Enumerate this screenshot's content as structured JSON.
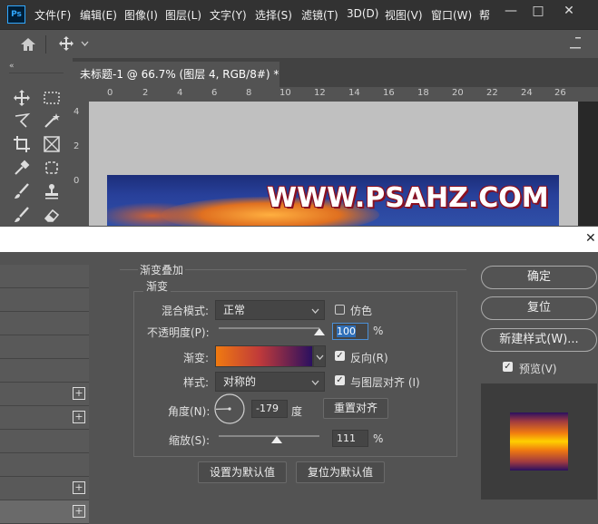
{
  "menubar": {
    "logo": "Ps",
    "items": [
      "文件(F)",
      "编辑(E)",
      "图像(I)",
      "图层(L)",
      "文字(Y)",
      "选择(S)",
      "滤镜(T)",
      "3D(D)",
      "视图(V)",
      "窗口(W)",
      "帮"
    ],
    "window_controls": [
      "—",
      "□",
      "✕"
    ]
  },
  "document": {
    "tab_title": "未标题-1 @ 66.7% (图层 4, RGB/8#) *",
    "tab_close": "×",
    "ruler_h": [
      "0",
      "2",
      "4",
      "6",
      "8",
      "10",
      "12",
      "14",
      "16",
      "18",
      "20",
      "22",
      "24",
      "26"
    ],
    "ruler_v": [
      "4",
      "2",
      "0"
    ],
    "watermark": "WWW.PSAHZ.COM"
  },
  "dialog": {
    "close": "✕",
    "section_title": "渐变叠加",
    "group_title": "渐变",
    "blend_mode_label": "混合模式:",
    "blend_mode_value": "正常",
    "dither_label": "仿色",
    "opacity_label": "不透明度(P):",
    "opacity_value": "100",
    "percent": "%",
    "gradient_label": "渐变:",
    "reverse_label": "反向(R)",
    "style_label": "样式:",
    "style_value": "对称的",
    "align_label": "与图层对齐 (I)",
    "angle_label": "角度(N):",
    "angle_value": "-179",
    "degree": "度",
    "reset_align_button": "重置对齐",
    "scale_label": "缩放(S):",
    "scale_value": "111",
    "set_default_button": "设置为默认值",
    "reset_default_button": "复位为默认值",
    "ok_button": "确定",
    "reset_button": "复位",
    "new_style_button": "新建样式(W)...",
    "preview_label": "预览(V)",
    "opacity_level": 1.0,
    "scale_level": 0.58,
    "checkbox_states": {
      "dither": false,
      "reverse": true,
      "align": true,
      "preview": true
    },
    "colors": {
      "gradient_start": "#f07a10",
      "gradient_end": "#2a1060"
    }
  }
}
